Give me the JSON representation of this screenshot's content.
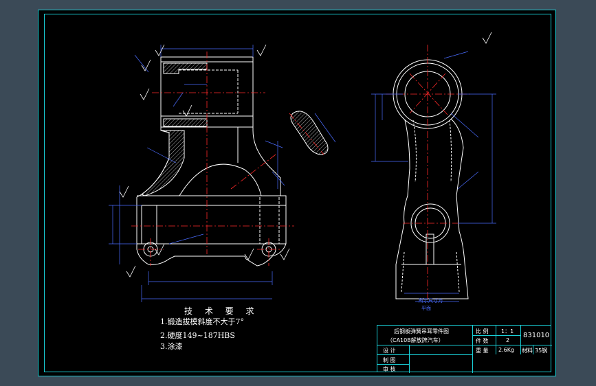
{
  "tech_requirements": {
    "title": "技 术 要 求",
    "items": [
      "1.锻造拔模斜度不大于7°",
      "2.硬度149~187HBS",
      "3.涂漆"
    ]
  },
  "title_block": {
    "part_name": "后钢板弹簧吊耳零件图",
    "vehicle": "（CA10B解放牌汽车）",
    "scale_label": "比 例",
    "scale_value": "1：1",
    "qty_label": "件 数",
    "qty_value": "2",
    "weight_label": "重 量",
    "weight_value": "2.6Kg",
    "material_label": "材料",
    "material_value": "35钢",
    "drawing_no": "831010",
    "design_label": "设 计",
    "draw_label": "制 图",
    "review_label": "审 核"
  },
  "side_view_note": [
    "所示尺寸为",
    "平面"
  ],
  "colors": {
    "background": "#000000",
    "frame": "#19d0d8",
    "outline": "#ffffff",
    "center_line": "#ff2a2a",
    "dimension": "#4a6cff",
    "window_outer": "#3b4a57"
  }
}
